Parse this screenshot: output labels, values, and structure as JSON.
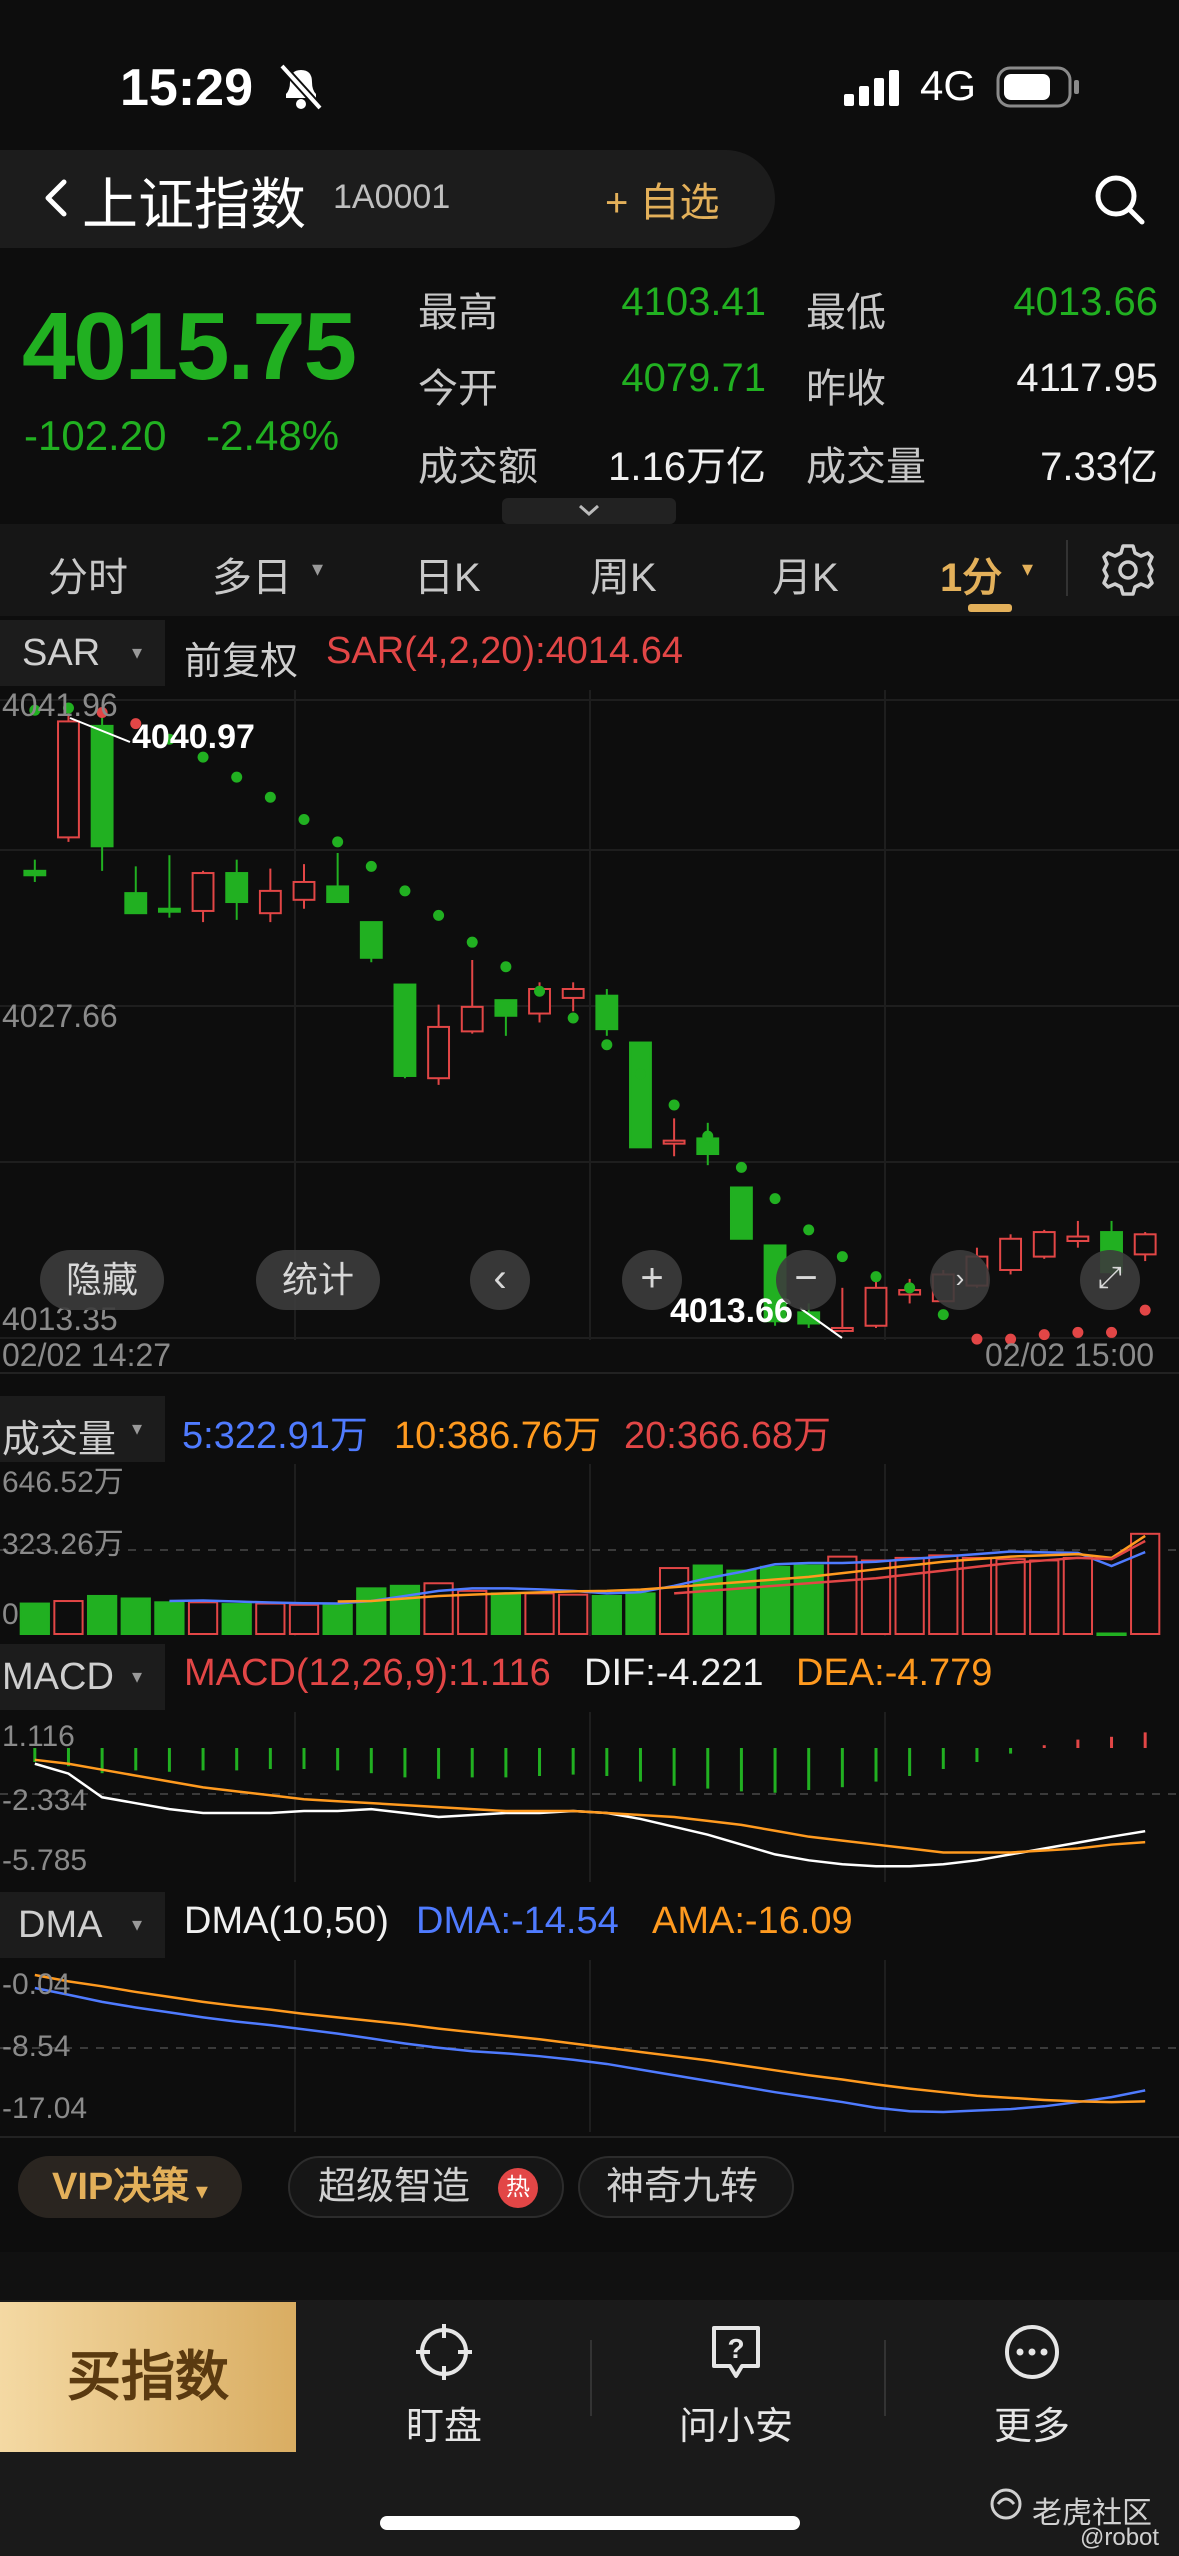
{
  "status_bar": {
    "time": "15:29",
    "network": "4G"
  },
  "header": {
    "title": "上证指数",
    "code": "1A0001",
    "watch_label": "+ 自选"
  },
  "quote": {
    "last_price": "4015.75",
    "change_abs": "-102.20",
    "change_pct": "-2.48%",
    "stats": [
      {
        "label": "最高",
        "value": "4103.41"
      },
      {
        "label": "最低",
        "value": "4013.66"
      },
      {
        "label": "今开",
        "value": "4079.71"
      },
      {
        "label": "昨收",
        "value": "4117.95"
      },
      {
        "label": "成交额",
        "value": "1.16万亿"
      },
      {
        "label": "成交量",
        "value": "7.33亿"
      }
    ]
  },
  "tabs": [
    "分时",
    "多日",
    "日K",
    "周K",
    "月K",
    "1分"
  ],
  "active_tab": "1分",
  "main_chart": {
    "indicator_select": "SAR",
    "adjust_label": "前复权",
    "indicator_value": "SAR(4,2,20):4014.64",
    "y_labels": [
      "4041.96",
      "4027.66",
      "4013.35"
    ],
    "high_marker": "4040.97",
    "low_marker": "4013.66",
    "time_start": "02/02 14:27",
    "time_end": "02/02 15:00",
    "controls": {
      "hide": "隐藏",
      "stats": "统计"
    }
  },
  "volume": {
    "label": "成交量",
    "ma5": "5:322.91万",
    "ma10": "10:386.76万",
    "ma20": "20:366.68万",
    "y_labels": [
      "646.52万",
      "323.26万",
      "0"
    ]
  },
  "macd": {
    "label": "MACD",
    "value": "MACD(12,26,9):1.116",
    "dif": "DIF:-4.221",
    "dea": "DEA:-4.779",
    "y_labels": [
      "1.116",
      "-2.334",
      "-5.785"
    ]
  },
  "dma": {
    "label": "DMA",
    "params": "DMA(10,50)",
    "dma": "DMA:-14.54",
    "ama": "AMA:-16.09",
    "y_labels": [
      "-0.04",
      "-8.54",
      "-17.04"
    ]
  },
  "features": {
    "vip": "VIP决策",
    "super": "超级智造",
    "hot": "热",
    "nine": "神奇九转"
  },
  "bottom_nav": {
    "buy": "买指数",
    "watch": "盯盘",
    "ask": "问小安",
    "more": "更多"
  },
  "watermark": {
    "brand": "老虎社区",
    "user": "@robot"
  },
  "colors": {
    "up": "#e24646",
    "down": "#21b021",
    "accent": "#e3b05a",
    "ma5": "#4f7bff",
    "ma10": "#ff9a1f",
    "ma20": "#e24646"
  },
  "chart_data": {
    "type": "candlestick",
    "candles": [
      {
        "o": 4034.3,
        "h": 4034.8,
        "l": 4033.8,
        "c": 4034.1
      },
      {
        "o": 4035.8,
        "h": 4041.5,
        "l": 4035.6,
        "c": 4041.0
      },
      {
        "o": 4040.8,
        "h": 4041.4,
        "l": 4034.3,
        "c": 4035.4
      },
      {
        "o": 4033.3,
        "h": 4034.5,
        "l": 4032.8,
        "c": 4032.4
      },
      {
        "o": 4032.6,
        "h": 4035.0,
        "l": 4032.2,
        "c": 4032.5
      },
      {
        "o": 4032.5,
        "h": 4034.3,
        "l": 4032.0,
        "c": 4034.2
      },
      {
        "o": 4034.2,
        "h": 4034.8,
        "l": 4032.1,
        "c": 4032.9
      },
      {
        "o": 4032.4,
        "h": 4034.4,
        "l": 4032.0,
        "c": 4033.4
      },
      {
        "o": 4033.0,
        "h": 4034.6,
        "l": 4032.6,
        "c": 4033.8
      },
      {
        "o": 4033.6,
        "h": 4035.1,
        "l": 4032.9,
        "c": 4032.9
      },
      {
        "o": 4032.0,
        "h": 4032.0,
        "l": 4030.2,
        "c": 4030.4
      },
      {
        "o": 4029.2,
        "h": 4029.2,
        "l": 4025.0,
        "c": 4025.1
      },
      {
        "o": 4025.0,
        "h": 4028.3,
        "l": 4024.7,
        "c": 4027.3
      },
      {
        "o": 4027.1,
        "h": 4030.3,
        "l": 4027.0,
        "c": 4028.2
      },
      {
        "o": 4028.5,
        "h": 4028.5,
        "l": 4026.9,
        "c": 4027.8
      },
      {
        "o": 4027.9,
        "h": 4029.3,
        "l": 4027.5,
        "c": 4029.0
      },
      {
        "o": 4028.6,
        "h": 4029.3,
        "l": 4028.0,
        "c": 4029.0
      },
      {
        "o": 4028.7,
        "h": 4029.0,
        "l": 4026.9,
        "c": 4027.2
      },
      {
        "o": 4026.6,
        "h": 4026.6,
        "l": 4021.9,
        "c": 4021.9
      },
      {
        "o": 4022.2,
        "h": 4023.2,
        "l": 4021.5,
        "c": 4022.2
      },
      {
        "o": 4022.3,
        "h": 4023.0,
        "l": 4021.1,
        "c": 4021.6
      },
      {
        "o": 4020.1,
        "h": 4020.1,
        "l": 4017.8,
        "c": 4017.8
      },
      {
        "o": 4017.5,
        "h": 4017.5,
        "l": 4013.9,
        "c": 4014.1
      },
      {
        "o": 4014.5,
        "h": 4014.9,
        "l": 4013.8,
        "c": 4014.0
      },
      {
        "o": 4013.8,
        "h": 4015.6,
        "l": 4013.6,
        "c": 4013.8
      },
      {
        "o": 4013.9,
        "h": 4015.9,
        "l": 4013.8,
        "c": 4015.6
      },
      {
        "o": 4015.3,
        "h": 4016.0,
        "l": 4014.9,
        "c": 4015.5
      },
      {
        "o": 4015.0,
        "h": 4016.4,
        "l": 4015.0,
        "c": 4016.2
      },
      {
        "o": 4015.7,
        "h": 4017.4,
        "l": 4015.6,
        "c": 4017.0
      },
      {
        "o": 4016.4,
        "h": 4018.0,
        "l": 4016.2,
        "c": 4017.8
      },
      {
        "o": 4017.0,
        "h": 4018.2,
        "l": 4016.9,
        "c": 4018.1
      },
      {
        "o": 4017.7,
        "h": 4018.6,
        "l": 4017.4,
        "c": 4017.9
      },
      {
        "o": 4018.1,
        "h": 4018.6,
        "l": 4016.2,
        "c": 4016.3
      },
      {
        "o": 4017.1,
        "h": 4018.1,
        "l": 4016.8,
        "c": 4018.0
      }
    ],
    "sar": [
      4041.5,
      4041.6,
      4041.4,
      4040.9,
      4040.2,
      4039.4,
      4038.5,
      4037.6,
      4036.6,
      4035.6,
      4034.5,
      4033.4,
      4032.3,
      4031.1,
      4030.0,
      4028.9,
      4027.7,
      4026.5,
      4025.2,
      4023.8,
      4022.4,
      4021.0,
      4019.6,
      4018.2,
      4017.0,
      4016.1,
      4015.6,
      4014.4,
      4013.3,
      4013.3,
      4013.5,
      4013.6,
      4013.6,
      4014.6
    ],
    "sar_color": [
      "down",
      "down",
      "up",
      "up",
      "down",
      "down",
      "down",
      "down",
      "down",
      "down",
      "down",
      "down",
      "down",
      "down",
      "down",
      "down",
      "down",
      "down",
      "down",
      "down",
      "down",
      "down",
      "down",
      "down",
      "down",
      "down",
      "down",
      "down",
      "up",
      "up",
      "up",
      "up",
      "up",
      "up"
    ],
    "volume": [
      120,
      130,
      150,
      140,
      125,
      125,
      118,
      120,
      115,
      115,
      180,
      190,
      200,
      170,
      160,
      160,
      155,
      150,
      160,
      260,
      270,
      250,
      265,
      270,
      305,
      290,
      300,
      310,
      300,
      295,
      290,
      300,
      2,
      395
    ],
    "ma5": [
      0,
      0,
      0,
      0,
      130,
      132,
      128,
      124,
      121,
      120,
      130,
      150,
      170,
      180,
      180,
      176,
      170,
      160,
      165,
      190,
      220,
      245,
      275,
      280,
      280,
      285,
      295,
      305,
      315,
      325,
      322,
      320,
      268,
      322.91
    ],
    "ma10": [
      0,
      0,
      0,
      0,
      0,
      0,
      0,
      0,
      0,
      128,
      130,
      140,
      150,
      155,
      160,
      164,
      168,
      170,
      175,
      185,
      195,
      205,
      215,
      225,
      240,
      255,
      270,
      285,
      295,
      305,
      310,
      315,
      300,
      386.76
    ],
    "ma20": [
      0,
      0,
      0,
      0,
      0,
      0,
      0,
      0,
      0,
      0,
      0,
      0,
      0,
      0,
      0,
      0,
      0,
      0,
      0,
      160,
      170,
      180,
      190,
      200,
      210,
      220,
      235,
      250,
      265,
      280,
      290,
      300,
      295,
      366.68
    ],
    "macd_hist": [
      -1.0,
      -1.3,
      -1.8,
      -1.6,
      -1.7,
      -1.6,
      -1.6,
      -1.5,
      -1.5,
      -1.6,
      -1.8,
      -2.1,
      -2.2,
      -2.1,
      -2.1,
      -2.0,
      -1.9,
      -2.0,
      -2.4,
      -2.7,
      -2.9,
      -3.1,
      -3.2,
      -3.0,
      -2.8,
      -2.4,
      -2.0,
      -1.5,
      -1.0,
      -0.4,
      0.2,
      0.6,
      0.8,
      1.116
    ],
    "dif": [
      -0.8,
      -1.3,
      -2.5,
      -2.8,
      -3.1,
      -3.3,
      -3.3,
      -3.3,
      -3.2,
      -3.2,
      -3.1,
      -3.3,
      -3.5,
      -3.4,
      -3.3,
      -3.3,
      -3.2,
      -3.3,
      -3.6,
      -4.0,
      -4.4,
      -4.9,
      -5.4,
      -5.7,
      -5.9,
      -6.0,
      -6.0,
      -5.9,
      -5.7,
      -5.4,
      -5.1,
      -4.8,
      -4.5,
      -4.221
    ],
    "dea": [
      -0.6,
      -0.8,
      -1.1,
      -1.4,
      -1.7,
      -2.0,
      -2.2,
      -2.4,
      -2.6,
      -2.7,
      -2.8,
      -2.9,
      -3.0,
      -3.1,
      -3.2,
      -3.2,
      -3.2,
      -3.3,
      -3.4,
      -3.5,
      -3.7,
      -3.9,
      -4.2,
      -4.5,
      -4.7,
      -4.9,
      -5.1,
      -5.3,
      -5.3,
      -5.3,
      -5.2,
      -5.1,
      -4.9,
      -4.779
    ],
    "dma_line": [
      -0.04,
      -1.0,
      -2.0,
      -2.8,
      -3.5,
      -4.2,
      -4.8,
      -5.3,
      -5.9,
      -6.5,
      -7.2,
      -7.9,
      -8.5,
      -9.0,
      -9.3,
      -9.7,
      -10.2,
      -10.8,
      -11.6,
      -12.4,
      -13.2,
      -14.0,
      -14.8,
      -15.5,
      -16.2,
      -17.0,
      -17.5,
      -17.6,
      -17.4,
      -17.2,
      -16.8,
      -16.2,
      -15.5,
      -14.54
    ],
    "ama_line": [
      1.8,
      0.9,
      0.2,
      -0.6,
      -1.3,
      -2.0,
      -2.6,
      -3.1,
      -3.7,
      -4.2,
      -4.7,
      -5.2,
      -5.8,
      -6.3,
      -6.8,
      -7.3,
      -7.9,
      -8.5,
      -9.1,
      -9.7,
      -10.3,
      -11.0,
      -11.7,
      -12.4,
      -13.0,
      -13.7,
      -14.3,
      -14.8,
      -15.3,
      -15.6,
      -15.9,
      -16.1,
      -16.2,
      -16.09
    ],
    "price_ylim": [
      4013.35,
      4041.96
    ],
    "volume_ylim": [
      0,
      646.52
    ],
    "macd_ylim": [
      -5.785,
      1.116
    ],
    "dma_ylim": [
      -17.04,
      -0.04
    ]
  }
}
